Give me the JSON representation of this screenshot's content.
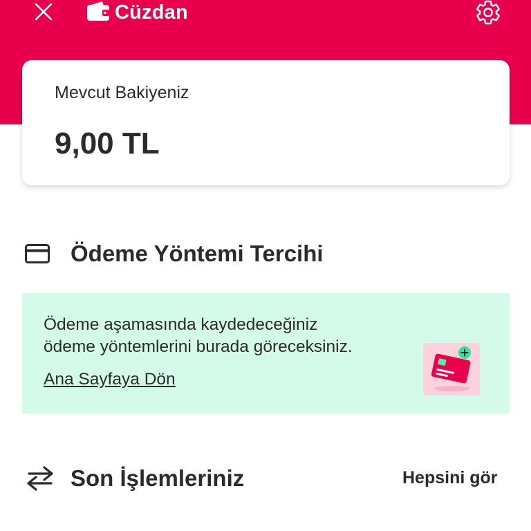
{
  "header": {
    "title": "Cüzdan",
    "icons": {
      "close": "close-icon",
      "wallet": "wallet-icon",
      "settings": "gear-icon"
    },
    "background_color": "#e8004c"
  },
  "balance": {
    "label": "Mevcut Bakiyeniz",
    "amount": "9,00 TL"
  },
  "payment_section": {
    "icon": "credit-card-icon",
    "title": "Ödeme Yöntemi Tercihi",
    "info_line_1": "Ödeme aşamasında kaydedeceğiniz",
    "info_line_2": "ödeme yöntemlerini burada göreceksiniz.",
    "link_label": "Ana Sayfaya Dön",
    "illustration": "add-card-illustration",
    "info_background_color": "#d4fbe9"
  },
  "transactions_section": {
    "icon": "swap-arrows-icon",
    "title": "Son İşlemleriniz",
    "see_all_label": "Hepsini gör"
  }
}
